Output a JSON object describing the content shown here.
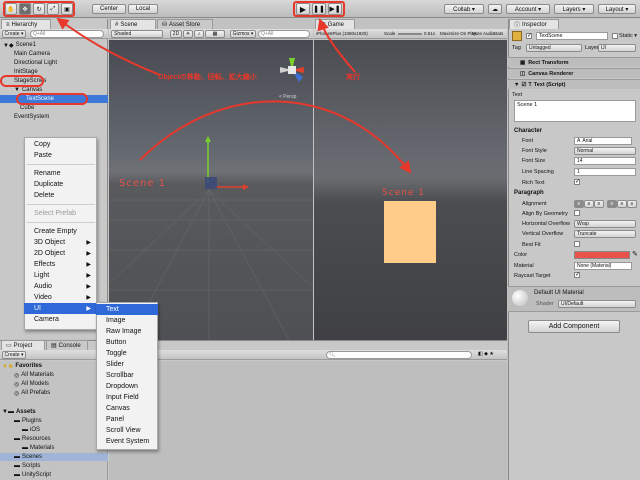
{
  "toolbar": {
    "center": "Center",
    "local": "Local",
    "collab": "Collab ▾",
    "account": "Account ▾",
    "layers": "Layers ▾",
    "layout": "Layout ▾"
  },
  "hierarchy": {
    "tab": "Hierarchy",
    "create": "Create ▾",
    "search_placeholder": "Q+All",
    "items": [
      "Scene1",
      "Main Camera",
      "Directional Light",
      "InitStage",
      "StageScnes",
      "Canvas",
      "TextScene",
      "Cube",
      "EventSystem"
    ]
  },
  "scene": {
    "tab": "Scene",
    "asset_tab": "Asset Store",
    "shaded": "Shaded",
    "mode2d": "2D",
    "gizmos": "Gizmos ▾",
    "search": "Q+All",
    "persp": "< Persp",
    "scene_text": "Scene 1"
  },
  "game": {
    "tab": "Game",
    "display": "iPhone6Plus (1080x1920)",
    "scale_label": "Scale",
    "scale_value": "0.61x",
    "maximize": "Maximize On Play",
    "mute": "Mute Audio",
    "stats": "Stats",
    "scene_text": "Scene 1"
  },
  "annotations": {
    "object_tools": "Objectの移動、回転、拡大縮小",
    "run": "実行"
  },
  "context_menu": {
    "items": [
      "Copy",
      "Paste",
      "Rename",
      "Duplicate",
      "Delete",
      "Select Prefab",
      "Create Empty",
      "3D Object",
      "2D Object",
      "Effects",
      "Light",
      "Audio",
      "Video",
      "UI",
      "Camera"
    ]
  },
  "ui_submenu": {
    "items": [
      "Text",
      "Image",
      "Raw Image",
      "Button",
      "Toggle",
      "Slider",
      "Scrollbar",
      "Dropdown",
      "Input Field",
      "Canvas",
      "Panel",
      "Scroll View",
      "Event System"
    ]
  },
  "project": {
    "tab": "Project",
    "console_tab": "Console",
    "create": "Create ▾",
    "favorites": "Favorites",
    "fav_items": [
      "All Materials",
      "All Models",
      "All Prefabs"
    ],
    "assets": "Assets",
    "asset_items": [
      "Plugins",
      "iOS",
      "Resources",
      "Materials",
      "Scenes",
      "Scripts",
      "UnityScript"
    ]
  },
  "inspector": {
    "tab": "Inspector",
    "object_name": "TextScene",
    "static": "Static ▾",
    "tag_label": "Tag",
    "tag_value": "Untagged",
    "layer_label": "Layer",
    "layer_value": "UI",
    "rect_transform": "Rect Transform",
    "canvas_renderer": "Canvas Renderer",
    "text_script": "Text (Script)",
    "text_label": "Text",
    "text_value": "Scene 1",
    "character": "Character",
    "font": "Font",
    "font_value": "Arial",
    "font_style": "Font Style",
    "font_style_value": "Normal",
    "font_size": "Font Size",
    "font_size_value": "14",
    "line_spacing": "Line Spacing",
    "line_spacing_value": "1",
    "rich_text": "Rich Text",
    "paragraph": "Paragraph",
    "alignment": "Alignment",
    "align_geometry": "Align By Geometry",
    "h_overflow": "Horizontal Overflow",
    "h_overflow_value": "Wrap",
    "v_overflow": "Vertical Overflow",
    "v_overflow_value": "Truncate",
    "best_fit": "Best Fit",
    "color": "Color",
    "material": "Material",
    "material_value": "None (Material)",
    "raycast": "Raycast Target",
    "default_material": "Default UI Material",
    "shader": "Shader",
    "shader_value": "UI/Default",
    "add_component": "Add Component"
  },
  "colors": {
    "scene_text": "#e8524a",
    "panel": "#ffcc8a",
    "annotation": "#e8372b",
    "selected": "#3c78d8"
  }
}
